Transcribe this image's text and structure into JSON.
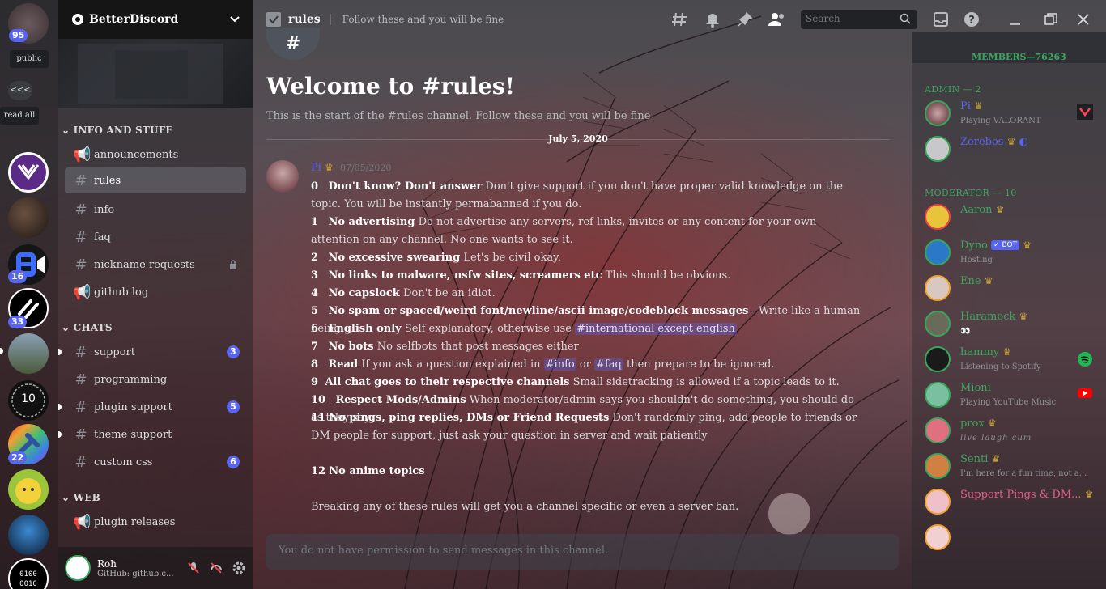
{
  "guild_rail": {
    "mention_count": "95",
    "public_label": "public",
    "collapse_label": "<<<",
    "read_all_label": "read all",
    "badges": [
      "16",
      "33",
      "22"
    ]
  },
  "server": {
    "name": "BetterDiscord"
  },
  "categories": [
    {
      "label": "INFO AND STUFF"
    },
    {
      "label": "CHATS"
    },
    {
      "label": "WEB"
    }
  ],
  "channels": [
    {
      "name": "announcements"
    },
    {
      "name": "rules"
    },
    {
      "name": "info"
    },
    {
      "name": "faq"
    },
    {
      "name": "nickname requests"
    },
    {
      "name": "github log"
    },
    {
      "name": "support",
      "count": "3"
    },
    {
      "name": "programming"
    },
    {
      "name": "plugin support",
      "count": "5"
    },
    {
      "name": "theme support"
    },
    {
      "name": "custom css",
      "count": "6"
    },
    {
      "name": "plugin releases"
    }
  ],
  "user_panel": {
    "name": "Roh",
    "status": "GitHub: github.c..."
  },
  "topbar": {
    "channel": "rules",
    "topic": "Follow these and you will be fine",
    "search_placeholder": "Search"
  },
  "welcome": {
    "heading": "Welcome to #rules!",
    "subtitle": "This is the start of the #rules channel. Follow these and you will be fine"
  },
  "date_divider": "July 5, 2020",
  "message": {
    "author": "Pi",
    "timestamp": "07/05/2020",
    "rules": [
      {
        "num": "0",
        "title": "Don't know? Don't answer",
        "body": "Don't give support if you don't have proper valid knowledge on the topic. You will be instantly permabanned if you do."
      },
      {
        "num": "1",
        "title": "No advertising",
        "body": "Do not advertise any servers, ref links, invites or any content for your own attention on any channel. No one wants to see it."
      },
      {
        "num": "2",
        "title": "No excessive swearing",
        "body": "Let's be civil okay."
      },
      {
        "num": "3",
        "title": "No links to malware, nsfw sites, screamers etc",
        "body": "This should be obvious."
      },
      {
        "num": "4",
        "title": "No capslock",
        "body": "Don't be an idiot."
      },
      {
        "num": "5",
        "title": "No spam or spaced/weird font/newline/ascii image/codeblock messages",
        "body": "- Write like a human being."
      },
      {
        "num": "6",
        "title": "English only",
        "body": "Self explanatory, otherwise use",
        "mention": "international except english"
      },
      {
        "num": "7",
        "title": "No bots",
        "body": "No selfbots that post messages either"
      },
      {
        "num": "8",
        "title": "Read",
        "body": "If you ask a question explained in",
        "mention": "info",
        "mid": "or",
        "mention2": "faq",
        "tail": "then prepare to be ignored."
      },
      {
        "num": "9",
        "title": "All chat goes to their respective channels",
        "body": "Small sidetracking is allowed if a topic leads to it."
      },
      {
        "num": "10",
        "title": "Respect Mods/Admins",
        "body": "When moderator/admin says you shouldn't do something, you should do as they say"
      },
      {
        "num": "11",
        "title": "No pings, ping replies, DMs or Friend Requests",
        "body": "Don't randomly ping, add people to friends or DM people for support, just ask your question in server and wait patiently"
      },
      {
        "num": "12",
        "title": "No anime topics",
        "body": ""
      }
    ],
    "footer": "Breaking any of these rules will get you a channel specific or even a server ban."
  },
  "composer_placeholder": "You do not have permission to send messages in this channel.",
  "members": {
    "header": "MEMBERS—76263",
    "groups": [
      {
        "label": "ADMIN — 2",
        "members": [
          {
            "name": "Pi",
            "status": "Playing VALORANT",
            "color": "#5865f2"
          },
          {
            "name": "Zerebos",
            "status": "",
            "color": "#5865f2"
          }
        ]
      },
      {
        "label": "MODERATOR — 10",
        "members": [
          {
            "name": "Aaron",
            "status": "",
            "color": "#3ba55d"
          },
          {
            "name": "Dyno",
            "status": "Hosting",
            "bot": "BOT",
            "color": "#3ba55d"
          },
          {
            "name": "Ene",
            "status": "",
            "color": "#3ba55d"
          },
          {
            "name": "Haramock",
            "status": "👀",
            "color": "#3ba55d"
          },
          {
            "name": "hammy",
            "status": "Listening to Spotify",
            "color": "#3ba55d"
          },
          {
            "name": "Mioni",
            "status": "Playing YouTube Music",
            "color": "#3ba55d"
          },
          {
            "name": "prox",
            "status": "live laugh cum",
            "color": "#3ba55d"
          },
          {
            "name": "Senti",
            "status": "I'm here for a fun time, not a...",
            "color": "#3ba55d"
          },
          {
            "name": "Support Pings & DM...",
            "status": "",
            "color": "#e85b8a"
          }
        ]
      }
    ]
  },
  "colors": {
    "accent": "#5865f2",
    "online": "#3ba55d",
    "crown": "#c8a033"
  }
}
